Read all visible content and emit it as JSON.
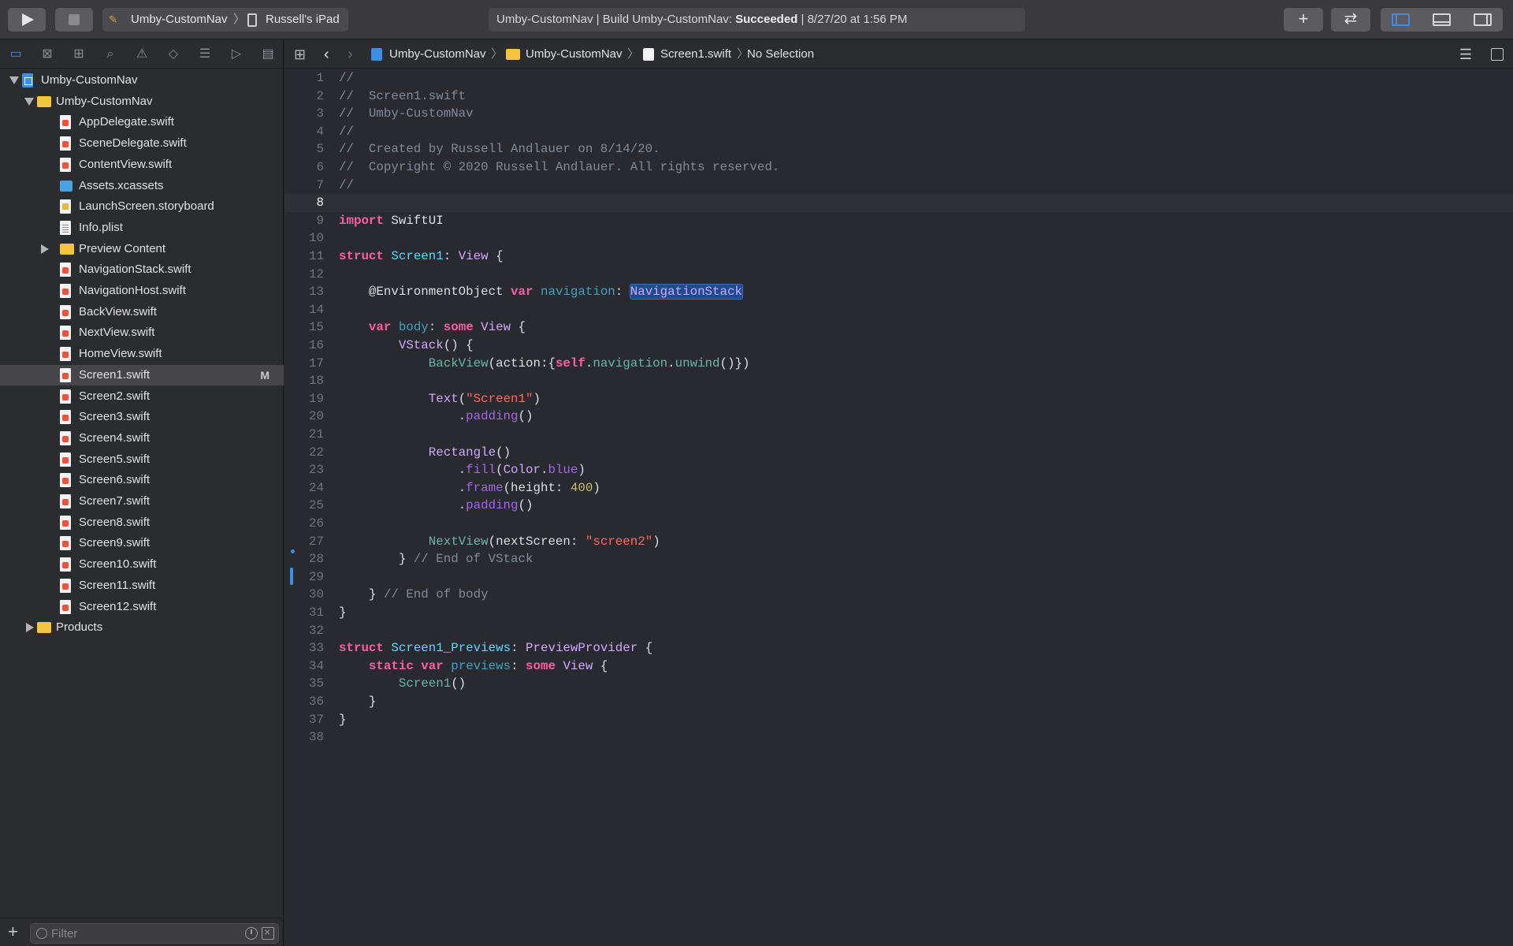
{
  "toolbar": {
    "scheme_name": "Umby-CustomNav",
    "chevron": "〉",
    "device": "Russell's iPad",
    "activity_prefix": "Umby-CustomNav | Build Umby-CustomNav: ",
    "activity_status": "Succeeded",
    "activity_suffix": " | 8/27/20 at 1:56 PM",
    "add_symbol": "+",
    "swap_symbol": "⇄"
  },
  "navigator": {
    "tabs": [
      "folder-icon",
      "source-control-icon",
      "symbol-icon",
      "find-icon",
      "issue-icon",
      "test-icon",
      "debug-icon",
      "breakpoint-icon",
      "report-icon"
    ],
    "tree": [
      {
        "label": "Umby-CustomNav",
        "indent": 0,
        "icon": "proj",
        "disclosure": "open"
      },
      {
        "label": "Umby-CustomNav",
        "indent": 1,
        "icon": "folder",
        "disclosure": "open"
      },
      {
        "label": "AppDelegate.swift",
        "indent": 2,
        "icon": "swift"
      },
      {
        "label": "SceneDelegate.swift",
        "indent": 2,
        "icon": "swift"
      },
      {
        "label": "ContentView.swift",
        "indent": 2,
        "icon": "swift"
      },
      {
        "label": "Assets.xcassets",
        "indent": 2,
        "icon": "assets"
      },
      {
        "label": "LaunchScreen.storyboard",
        "indent": 2,
        "icon": "story"
      },
      {
        "label": "Info.plist",
        "indent": 2,
        "icon": "plist"
      },
      {
        "label": "Preview Content",
        "indent": 2,
        "icon": "folder",
        "disclosure": "closed"
      },
      {
        "label": "NavigationStack.swift",
        "indent": 2,
        "icon": "swift"
      },
      {
        "label": "NavigationHost.swift",
        "indent": 2,
        "icon": "swift"
      },
      {
        "label": "BackView.swift",
        "indent": 2,
        "icon": "swift"
      },
      {
        "label": "NextView.swift",
        "indent": 2,
        "icon": "swift"
      },
      {
        "label": "HomeView.swift",
        "indent": 2,
        "icon": "swift"
      },
      {
        "label": "Screen1.swift",
        "indent": 2,
        "icon": "swift",
        "selected": true,
        "badge": "M"
      },
      {
        "label": "Screen2.swift",
        "indent": 2,
        "icon": "swift"
      },
      {
        "label": "Screen3.swift",
        "indent": 2,
        "icon": "swift"
      },
      {
        "label": "Screen4.swift",
        "indent": 2,
        "icon": "swift"
      },
      {
        "label": "Screen5.swift",
        "indent": 2,
        "icon": "swift"
      },
      {
        "label": "Screen6.swift",
        "indent": 2,
        "icon": "swift"
      },
      {
        "label": "Screen7.swift",
        "indent": 2,
        "icon": "swift"
      },
      {
        "label": "Screen8.swift",
        "indent": 2,
        "icon": "swift"
      },
      {
        "label": "Screen9.swift",
        "indent": 2,
        "icon": "swift"
      },
      {
        "label": "Screen10.swift",
        "indent": 2,
        "icon": "swift"
      },
      {
        "label": "Screen11.swift",
        "indent": 2,
        "icon": "swift"
      },
      {
        "label": "Screen12.swift",
        "indent": 2,
        "icon": "swift"
      },
      {
        "label": "Products",
        "indent": 1,
        "icon": "folder",
        "disclosure": "closed"
      }
    ],
    "filter_placeholder": "Filter",
    "filter_add": "+"
  },
  "jumpbar": {
    "crumbs": [
      "Umby-CustomNav",
      "Umby-CustomNav",
      "Screen1.swift",
      "No Selection"
    ],
    "separator": "〉",
    "back": "‹",
    "forward": "›"
  },
  "editor": {
    "current_line": 8,
    "lines": [
      [
        [
          "com",
          "//"
        ]
      ],
      [
        [
          "com",
          "//  Screen1.swift"
        ]
      ],
      [
        [
          "com",
          "//  Umby-CustomNav"
        ]
      ],
      [
        [
          "com",
          "//"
        ]
      ],
      [
        [
          "com",
          "//  Created by Russell Andlauer on 8/14/20."
        ]
      ],
      [
        [
          "com",
          "//  Copyright © 2020 Russell Andlauer. All rights reserved."
        ]
      ],
      [
        [
          "com",
          "//"
        ]
      ],
      [],
      [
        [
          "kw",
          "import"
        ],
        [
          "",
          " SwiftUI"
        ]
      ],
      [],
      [
        [
          "kw",
          "struct"
        ],
        [
          "",
          " "
        ],
        [
          "type",
          "Screen1"
        ],
        [
          "",
          ": "
        ],
        [
          "ty2",
          "View"
        ],
        [
          "",
          " {"
        ]
      ],
      [],
      [
        [
          "",
          "    "
        ],
        [
          "attr",
          "@EnvironmentObject"
        ],
        [
          "",
          " "
        ],
        [
          "kw",
          "var"
        ],
        [
          "",
          " "
        ],
        [
          "prop",
          "navigation"
        ],
        [
          "",
          ": "
        ],
        [
          "sel",
          "NavigationStack"
        ]
      ],
      [],
      [
        [
          "",
          "    "
        ],
        [
          "kw",
          "var"
        ],
        [
          "",
          " "
        ],
        [
          "prop",
          "body"
        ],
        [
          "",
          ": "
        ],
        [
          "kw",
          "some"
        ],
        [
          "",
          " "
        ],
        [
          "ty2",
          "View"
        ],
        [
          "",
          " {"
        ]
      ],
      [
        [
          "",
          "        "
        ],
        [
          "ty2",
          "VStack"
        ],
        [
          "",
          "() {"
        ]
      ],
      [
        [
          "",
          "            "
        ],
        [
          "proj",
          "BackView"
        ],
        [
          "",
          "(action:{"
        ],
        [
          "kw",
          "self"
        ],
        [
          "",
          "."
        ],
        [
          "proj",
          "navigation"
        ],
        [
          "",
          "."
        ],
        [
          "proj",
          "unwind"
        ],
        [
          "",
          "()})"
        ]
      ],
      [],
      [
        [
          "",
          "            "
        ],
        [
          "ty2",
          "Text"
        ],
        [
          "",
          "("
        ],
        [
          "str",
          "\"Screen1\""
        ],
        [
          "",
          ")"
        ]
      ],
      [
        [
          "",
          "                ."
        ],
        [
          "call",
          "padding"
        ],
        [
          "",
          "()"
        ]
      ],
      [],
      [
        [
          "",
          "            "
        ],
        [
          "ty2",
          "Rectangle"
        ],
        [
          "",
          "()"
        ]
      ],
      [
        [
          "",
          "                ."
        ],
        [
          "call",
          "fill"
        ],
        [
          "",
          "("
        ],
        [
          "ty2",
          "Color"
        ],
        [
          "",
          "."
        ],
        [
          "call",
          "blue"
        ],
        [
          "",
          ")"
        ]
      ],
      [
        [
          "",
          "                ."
        ],
        [
          "call",
          "frame"
        ],
        [
          "",
          "(height: "
        ],
        [
          "num",
          "400"
        ],
        [
          "",
          ")"
        ]
      ],
      [
        [
          "",
          "                ."
        ],
        [
          "call",
          "padding"
        ],
        [
          "",
          "()"
        ]
      ],
      [],
      [
        [
          "",
          "            "
        ],
        [
          "proj",
          "NextView"
        ],
        [
          "",
          "(nextScreen: "
        ],
        [
          "str",
          "\"screen2\""
        ],
        [
          "",
          ")"
        ]
      ],
      [
        [
          "",
          "        } "
        ],
        [
          "com",
          "// End of VStack"
        ]
      ],
      [],
      [
        [
          "",
          "    } "
        ],
        [
          "com",
          "// End of body"
        ]
      ],
      [
        [
          "",
          "}"
        ]
      ],
      [],
      [
        [
          "kw",
          "struct"
        ],
        [
          "",
          " "
        ],
        [
          "type",
          "Screen1_Previews"
        ],
        [
          "",
          ": "
        ],
        [
          "ty2",
          "PreviewProvider"
        ],
        [
          "",
          " {"
        ]
      ],
      [
        [
          "",
          "    "
        ],
        [
          "kw",
          "static"
        ],
        [
          "",
          " "
        ],
        [
          "kw",
          "var"
        ],
        [
          "",
          " "
        ],
        [
          "prop",
          "previews"
        ],
        [
          "",
          ": "
        ],
        [
          "kw",
          "some"
        ],
        [
          "",
          " "
        ],
        [
          "ty2",
          "View"
        ],
        [
          "",
          " {"
        ]
      ],
      [
        [
          "",
          "        "
        ],
        [
          "proj",
          "Screen1"
        ],
        [
          "",
          "()"
        ]
      ],
      [
        [
          "",
          "    }"
        ]
      ],
      [
        [
          "",
          "}"
        ]
      ],
      []
    ]
  }
}
